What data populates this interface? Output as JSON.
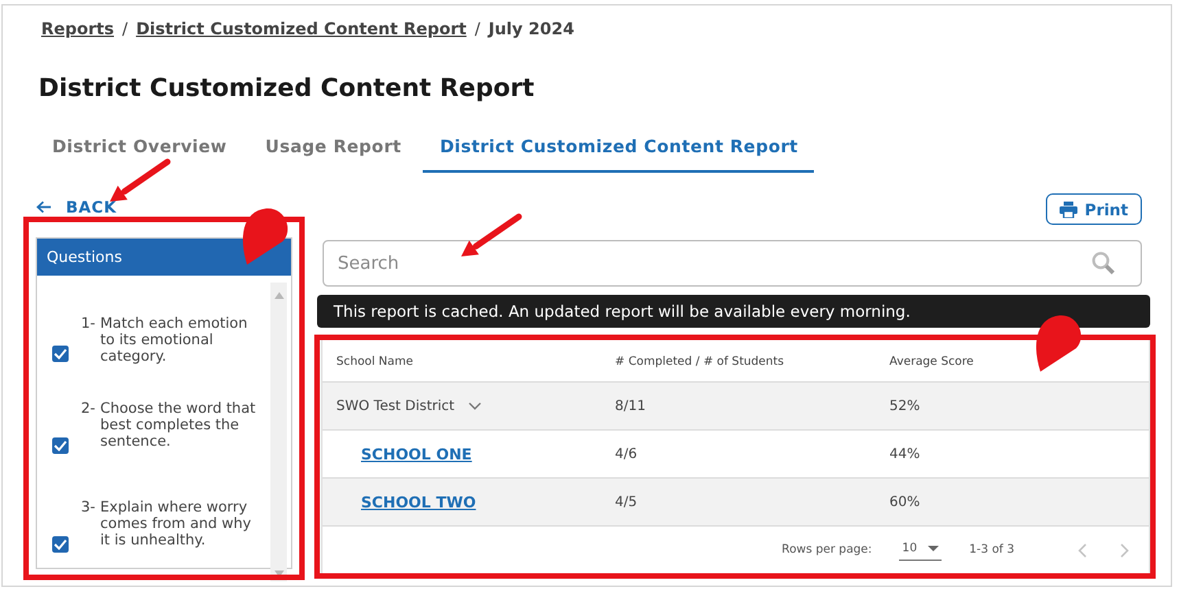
{
  "breadcrumb": [
    {
      "kind": "link",
      "label": "Reports"
    },
    {
      "kind": "separator",
      "label": "/"
    },
    {
      "kind": "link",
      "label": "District Customized Content Report"
    },
    {
      "kind": "separator",
      "label": "/"
    },
    {
      "kind": "current",
      "label": "July 2024"
    }
  ],
  "title": "District Customized Content Report",
  "tabs": [
    {
      "label": "District Overview",
      "selected": false
    },
    {
      "label": "Usage Report",
      "selected": false
    },
    {
      "label": "District Customized Content Report",
      "selected": true
    }
  ],
  "back": "BACK",
  "questions": {
    "title": "Questions",
    "items": [
      {
        "number": "1-",
        "text": "Match each emotion to its emotional category.",
        "checked": true
      },
      {
        "number": "2-",
        "text": "Choose the word that best completes the sentence.",
        "checked": true
      },
      {
        "number": "3-",
        "text": "Explain where worry comes from and why it is unhealthy.",
        "checked": true
      }
    ]
  },
  "print": "Print",
  "search": {
    "placeholder": "Search"
  },
  "notice": "This report is cached. An updated report will be available every morning.",
  "table": {
    "columns": [
      "School Name",
      "# Completed / # of Students",
      "Average Score"
    ],
    "rows": [
      {
        "kind": "group",
        "name": "SWO Test District",
        "completed": "8/11",
        "average": "52%"
      },
      {
        "kind": "school",
        "name": "SCHOOL ONE",
        "completed": "4/6",
        "average": "44%"
      },
      {
        "kind": "school",
        "name": "SCHOOL TWO",
        "completed": "4/5",
        "average": "60%"
      }
    ]
  },
  "pagination": {
    "rows_label": "Rows per page:",
    "rows_value": "10",
    "range": "1-3 of 3"
  }
}
